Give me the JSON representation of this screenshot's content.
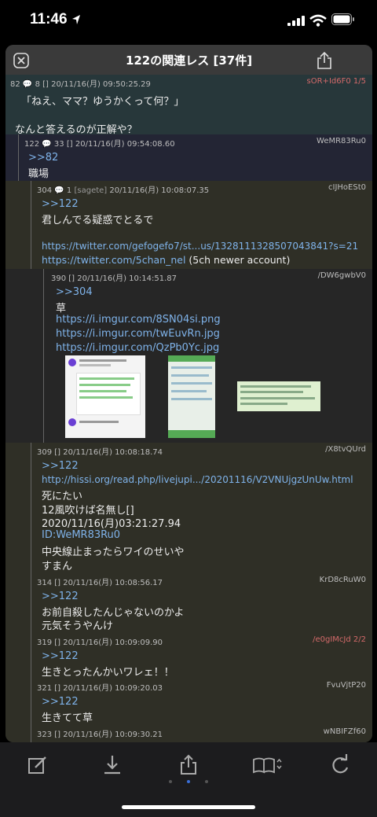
{
  "status": {
    "time": "11:46"
  },
  "modal": {
    "title": "122の関連レス [37件]"
  },
  "posts": [
    {
      "num": "82",
      "replies": "8",
      "sage": "[]",
      "date": "20/11/16(月) 09:50:25.29",
      "id": "sOR+Id6F0 1/5",
      "lines": [
        "「ねえ、ママ？ゆうかくって何？」",
        "",
        "なんと答えるのが正解や？"
      ]
    },
    {
      "num": "122",
      "replies": "33",
      "sage": "[]",
      "date": "20/11/16(月) 09:54:08.60",
      "id": "WeMR83Ru0",
      "lines": [
        ">>82",
        "職場"
      ]
    },
    {
      "num": "304",
      "replies": "1",
      "sage": "[sagete]",
      "date": "20/11/16(月) 10:08:07.35",
      "id": "cIJHoESt0",
      "lines": [
        ">>122",
        "君しんでる疑惑でとるで",
        "",
        "https://twitter.com/gefogefo7/st...us/1328111328507043841?s=21",
        "https://twitter.com/5chan_nel",
        "(5ch newer account)"
      ]
    },
    {
      "num": "390",
      "sage": "[]",
      "date": "20/11/16(月) 10:14:51.87",
      "id": "/DW6gwbV0",
      "lines": [
        ">>304",
        "草",
        "https://i.imgur.com/8SN04si.png",
        "https://i.imgur.com/twEuvRn.jpg",
        "https://i.imgur.com/QzPb0Yc.jpg"
      ]
    },
    {
      "num": "309",
      "sage": "[]",
      "date": "20/11/16(月) 10:08:18.74",
      "id": "/X8tvQUrd",
      "lines": [
        ">>122",
        "http://hissi.org/read.php/livejupi.../20201116/V2VNUjgzUnUw.html",
        "死にたい",
        "12風吹けば名無し[]",
        "2020/11/16(月)03:21:27.94",
        "ID:WeMR83Ru0",
        "中央線止まったらワイのせいや",
        "すまん"
      ]
    },
    {
      "num": "314",
      "sage": "[]",
      "date": "20/11/16(月) 10:08:56.17",
      "id": "KrD8cRuW0",
      "lines": [
        ">>122",
        "お前自殺したんじゃないのかよ",
        "元気そうやんけ"
      ]
    },
    {
      "num": "319",
      "sage": "[]",
      "date": "20/11/16(月) 10:09:09.90",
      "id": "/e0gIMcJd 2/2",
      "lines": [
        ">>122",
        "生きとったんかいワレェ！！"
      ]
    },
    {
      "num": "321",
      "sage": "[]",
      "date": "20/11/16(月) 10:09:20.03",
      "id": "FvuVjtP20",
      "lines": [
        ">>122",
        "生きてて草"
      ]
    },
    {
      "num": "323",
      "sage": "[]",
      "date": "20/11/16(月) 10:09:30.21",
      "id": "wNBIFZf60",
      "lines": []
    }
  ],
  "toolbar": {
    "icons": [
      "compose-icon",
      "download-icon",
      "share-icon",
      "book-icon",
      "refresh-icon"
    ]
  }
}
